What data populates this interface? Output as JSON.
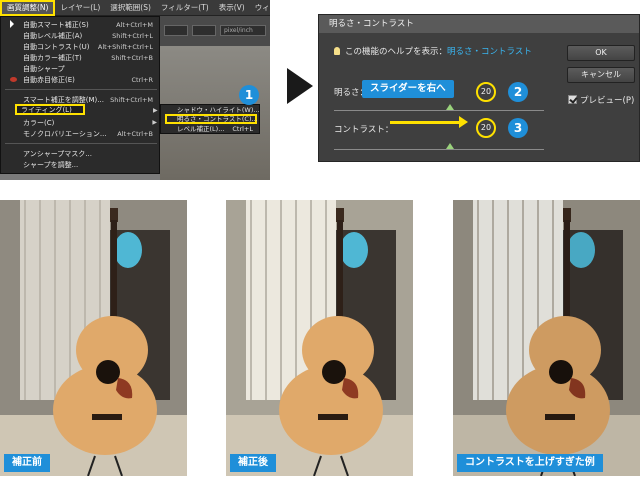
{
  "menu": {
    "bar": [
      "画質調整(N)",
      "レイヤー(L)",
      "選択範囲(S)",
      "フィルター(T)",
      "表示(V)",
      "ウィンドウ(W)"
    ],
    "toolbar_unit": "pixel/inch",
    "items": [
      {
        "label": "自動スマート補正(S)",
        "shortcut": "Alt+Ctrl+M"
      },
      {
        "label": "自動レベル補正(A)",
        "shortcut": "Shift+Ctrl+L"
      },
      {
        "label": "自動コントラスト(U)",
        "shortcut": "Alt+Shift+Ctrl+L"
      },
      {
        "label": "自動カラー補正(T)",
        "shortcut": "Shift+Ctrl+B"
      },
      {
        "label": "自動シャープ",
        "shortcut": ""
      },
      {
        "label": "自動赤目修正(E)",
        "shortcut": "Ctrl+R"
      },
      {
        "label": "スマート補正を調整(M)...",
        "shortcut": "Shift+Ctrl+M"
      },
      {
        "label": "ライティング(L)",
        "shortcut": ""
      },
      {
        "label": "カラー(C)",
        "shortcut": ""
      },
      {
        "label": "モノクロバリエーション...",
        "shortcut": "Alt+Ctrl+B"
      },
      {
        "label": "アンシャープマスク...",
        "shortcut": ""
      },
      {
        "label": "シャープを調整...",
        "shortcut": ""
      }
    ],
    "submenu": [
      {
        "label": "シャドウ・ハイライト(W)...",
        "shortcut": ""
      },
      {
        "label": "明るさ・コントラスト(C)...",
        "shortcut": ""
      },
      {
        "label": "レベル補正(L)...",
        "shortcut": "Ctrl+L"
      }
    ]
  },
  "steps": [
    "1",
    "2",
    "3"
  ],
  "dialog": {
    "title": "明るさ・コントラスト",
    "help_prefix": "この機能のヘルプを表示：",
    "help_link": "明るさ・コントラスト",
    "brightness_label": "明るさ：",
    "brightness_value": "20",
    "contrast_label": "コントラスト：",
    "contrast_value": "20",
    "callout": "スライダーを右へ",
    "ok": "OK",
    "cancel": "キャンセル",
    "preview": "プレビュー(P)",
    "brightness_level": 0.55,
    "contrast_level": 0.55
  },
  "photos": [
    {
      "label": "補正前",
      "bg": "#8f8a80",
      "wall": "#d6d2c8"
    },
    {
      "label": "補正後",
      "bg": "#a8a396",
      "wall": "#ece8de"
    },
    {
      "label": "コントラストを上げすぎた例",
      "bg": "#9a9488",
      "wall": "#f4f2ec"
    }
  ],
  "colors": {
    "accent": "#1f8fd9",
    "highlight": "#ffe100"
  }
}
